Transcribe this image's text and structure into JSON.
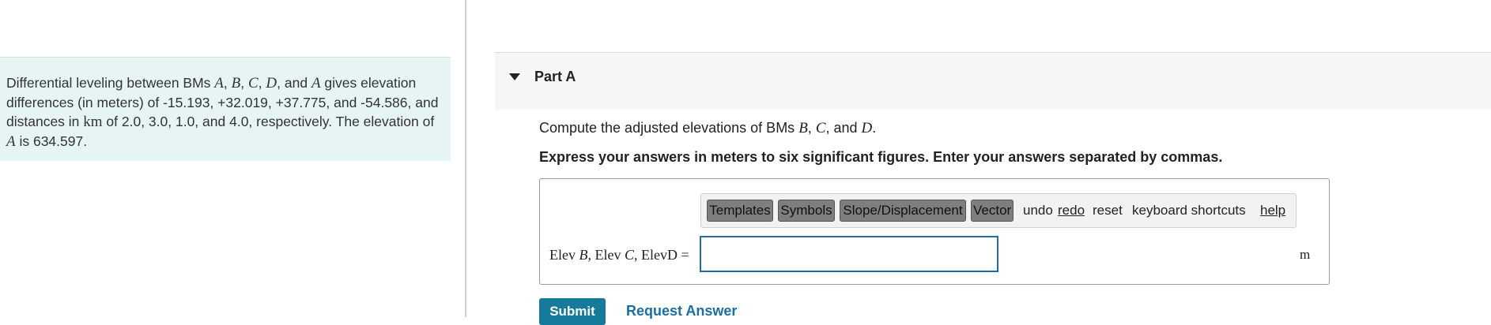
{
  "problem": {
    "t1": "Differential leveling between BMs ",
    "A": "A",
    "comma1": ", ",
    "B": "B",
    "comma2": ", ",
    "C": "C",
    "comma3": ", ",
    "D": "D",
    "and": ", and ",
    "A2": "A",
    "t2": " gives elevation differences (in meters) of -15.193, +32.019, +37.775, and -54.586, and distances in ",
    "km": "km",
    "t3": " of 2.0, 3.0, 1.0, and 4.0, respectively. The elevation of ",
    "A3": "A",
    "t4": " is 634.597."
  },
  "part": {
    "title": "Part A"
  },
  "prompt": {
    "t1": "Compute the adjusted elevations of BMs ",
    "B": "B",
    "comma": ", ",
    "C": "C",
    "and": ", and ",
    "D": "D",
    "end": "."
  },
  "instruction": "Express your answers in meters to six significant figures. Enter your answers separated by commas.",
  "toolbar": {
    "templates": "Templates",
    "symbols": "Symbols",
    "slope": "Slope/Displacement",
    "vector": "Vector",
    "undo": "undo",
    "redo": "redo",
    "reset": "reset",
    "shortcuts": "keyboard shortcuts",
    "help": "help"
  },
  "answer": {
    "label_elev1": "Elev ",
    "label_B": "B",
    "label_sep1": ", Elev ",
    "label_C": "C",
    "label_sep2": ", Elev",
    "label_D": "D",
    "label_eq": " =",
    "value": "",
    "unit": "m"
  },
  "actions": {
    "submit": "Submit",
    "request": "Request Answer"
  }
}
